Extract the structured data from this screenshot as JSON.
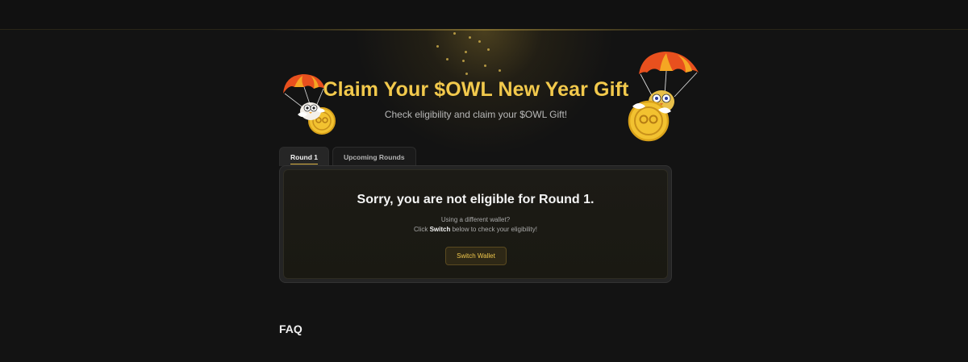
{
  "hero": {
    "title": "Claim Your $OWL New Year Gift",
    "subtitle": "Check eligibility and claim your $OWL Gift!"
  },
  "tabs": [
    {
      "label": "Round 1",
      "active": true
    },
    {
      "label": "Upcoming Rounds",
      "active": false
    }
  ],
  "panel": {
    "heading": "Sorry, you are not eligible for Round 1.",
    "line1": "Using a different wallet?",
    "line2_prefix": "Click ",
    "line2_bold": "Switch",
    "line2_suffix": " below to check your eligibility!",
    "button_label": "Switch Wallet"
  },
  "faq": {
    "title": "FAQ"
  },
  "colors": {
    "accent": "#f2c94c",
    "background": "#131313",
    "parachute": "#e8501e",
    "coin": "#f2c230"
  },
  "icons": {
    "left_mascot": "owl-parachute-coin-icon",
    "right_mascot": "owl-parachute-coin-icon"
  }
}
